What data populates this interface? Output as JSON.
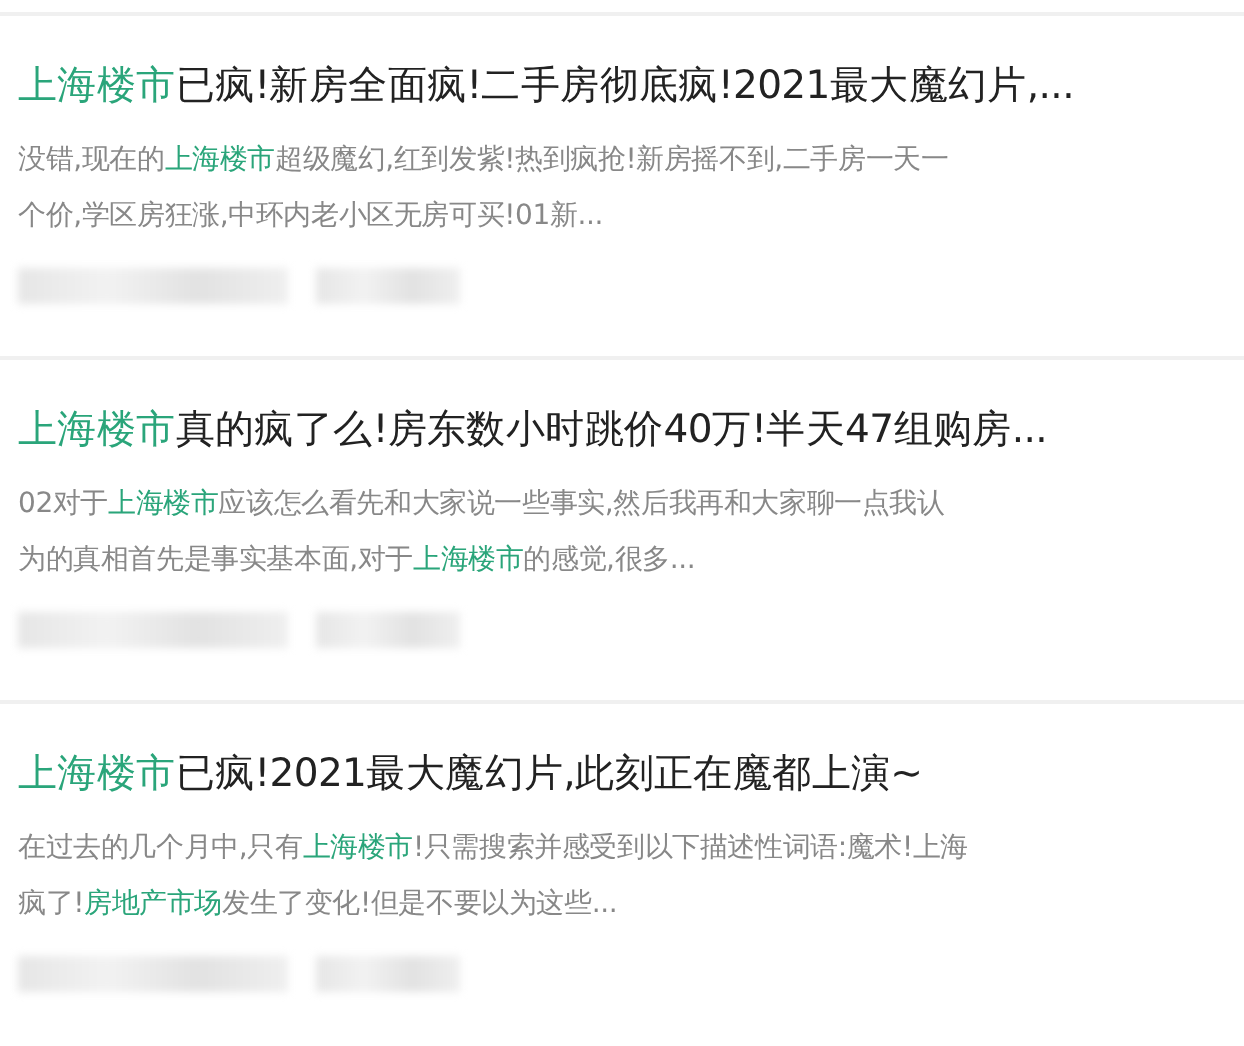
{
  "results": [
    {
      "title": [
        {
          "text": "上海楼市",
          "highlight": true
        },
        {
          "text": "已疯!新房全面疯!二手房彻底疯!2021最大魔幻片,...",
          "highlight": false
        }
      ],
      "snippet": [
        [
          {
            "text": "没错,现在的",
            "highlight": false
          },
          {
            "text": "上海楼市",
            "highlight": true
          },
          {
            "text": "超级魔幻,红到发紫!热到疯抢!新房摇不到,二手房一天一",
            "highlight": false
          }
        ],
        [
          {
            "text": "个价,学区房狂涨,中环内老小区无房可买!01新...",
            "highlight": false
          }
        ]
      ]
    },
    {
      "title": [
        {
          "text": "上海楼市",
          "highlight": true
        },
        {
          "text": "真的疯了么!房东数小时跳价40万!半天47组购房...",
          "highlight": false
        }
      ],
      "snippet": [
        [
          {
            "text": "02对于",
            "highlight": false
          },
          {
            "text": "上海楼市",
            "highlight": true
          },
          {
            "text": "应该怎么看先和大家说一些事实,然后我再和大家聊一点我认",
            "highlight": false
          }
        ],
        [
          {
            "text": "为的真相首先是事实基本面,对于",
            "highlight": false
          },
          {
            "text": "上海楼市",
            "highlight": true
          },
          {
            "text": "的感觉,很多...",
            "highlight": false
          }
        ]
      ]
    },
    {
      "title": [
        {
          "text": "上海楼市",
          "highlight": true
        },
        {
          "text": "已疯!2021最大魔幻片,此刻正在魔都上演~",
          "highlight": false
        }
      ],
      "snippet": [
        [
          {
            "text": "在过去的几个月中,只有",
            "highlight": false
          },
          {
            "text": "上海楼市",
            "highlight": true
          },
          {
            "text": "!只需搜索并感受到以下描述性词语:魔术!上海",
            "highlight": false
          }
        ],
        [
          {
            "text": "疯了!",
            "highlight": false
          },
          {
            "text": "房地产市场",
            "highlight": true
          },
          {
            "text": "发生了变化!但是不要以为这些...",
            "highlight": false
          }
        ]
      ]
    }
  ]
}
